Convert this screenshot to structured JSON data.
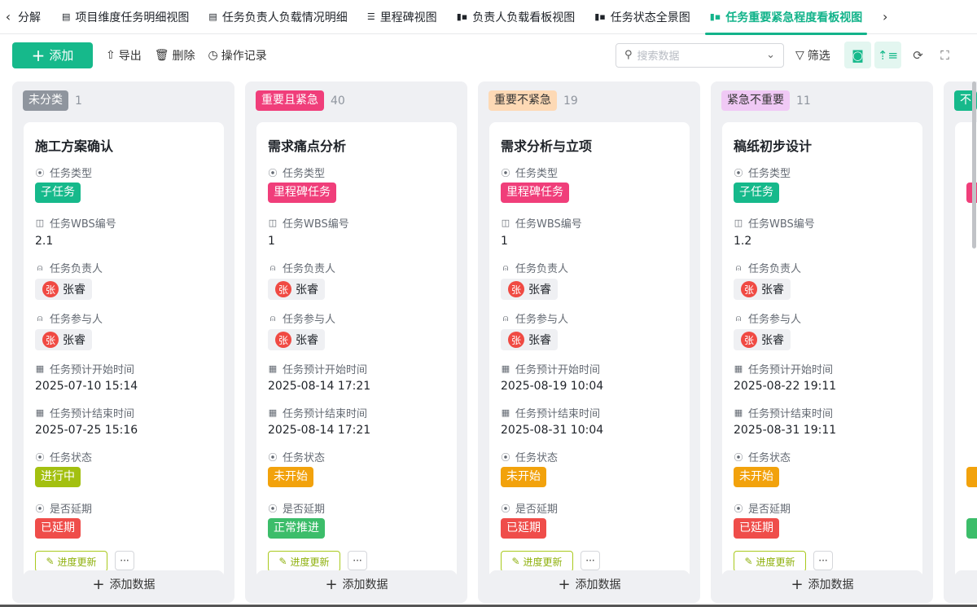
{
  "tabs": [
    {
      "label": "分解",
      "icon": "chevron-left-icon"
    },
    {
      "label": "项目维度任务明细视图",
      "icon": "table-icon"
    },
    {
      "label": "任务负责人负载情况明细",
      "icon": "table-icon"
    },
    {
      "label": "里程碑视图",
      "icon": "milestone-icon"
    },
    {
      "label": "负责人负载看板视图",
      "icon": "kanban-icon"
    },
    {
      "label": "任务状态全景图",
      "icon": "kanban-icon"
    },
    {
      "label": "任务重要紧急程度看板视图",
      "icon": "kanban-icon",
      "active": true
    }
  ],
  "toolbar": {
    "add": "添加",
    "export": "导出",
    "delete": "删除",
    "history": "操作记录",
    "search_placeholder": "搜索数据",
    "filter": "筛选"
  },
  "field_labels": {
    "type": "任务类型",
    "wbs": "任务WBS编号",
    "owner": "任务负责人",
    "participants": "任务参与人",
    "start": "任务预计开始时间",
    "end": "任务预计结束时间",
    "status": "任务状态",
    "delay": "是否延期"
  },
  "card_actions": {
    "progress": "进度更新",
    "more": "···"
  },
  "add_data": "添加数据",
  "colors": {
    "accent": "#16b98b",
    "sub_task": "#16b98b",
    "milestone": "#f03e7a",
    "in_progress": "#a3c010",
    "not_started": "#f2a20c",
    "delayed": "#ef4d4a",
    "normal": "#3cbd6a"
  },
  "columns": [
    {
      "label": "未分类",
      "count": "1",
      "bg": "#8f959e",
      "fg": "#fff",
      "card": {
        "title": "施工方案确认",
        "type": "子任务",
        "type_color": "#16b98b",
        "wbs": "2.1",
        "owner": "张睿",
        "owner_initial": "张",
        "participant": "张睿",
        "participant_initial": "张",
        "start": "2025-07-10 15:14",
        "end": "2025-07-25 15:16",
        "status": "进行中",
        "status_color": "#a3c010",
        "delay": "已延期",
        "delay_color": "#ef4d4a"
      }
    },
    {
      "label": "重要且紧急",
      "count": "40",
      "bg": "#f03e7a",
      "fg": "#fff",
      "card": {
        "title": "需求痛点分析",
        "type": "里程碑任务",
        "type_color": "#f03e7a",
        "wbs": "1",
        "owner": "张睿",
        "owner_initial": "张",
        "participant": "张睿",
        "participant_initial": "张",
        "start": "2025-08-14 17:21",
        "end": "2025-08-14 17:21",
        "status": "未开始",
        "status_color": "#f2a20c",
        "delay": "正常推进",
        "delay_color": "#3cbd6a"
      }
    },
    {
      "label": "重要不紧急",
      "count": "19",
      "bg": "#fdd9b5",
      "fg": "#333",
      "card": {
        "title": "需求分析与立项",
        "type": "里程碑任务",
        "type_color": "#f03e7a",
        "wbs": "1",
        "owner": "张睿",
        "owner_initial": "张",
        "participant": "张睿",
        "participant_initial": "张",
        "start": "2025-08-19 10:04",
        "end": "2025-08-31 10:04",
        "status": "未开始",
        "status_color": "#f2a20c",
        "delay": "已延期",
        "delay_color": "#ef4d4a"
      }
    },
    {
      "label": "紧急不重要",
      "count": "11",
      "bg": "#f0c9f5",
      "fg": "#333",
      "card": {
        "title": "稿纸初步设计",
        "type": "子任务",
        "type_color": "#16b98b",
        "wbs": "1.2",
        "owner": "张睿",
        "owner_initial": "张",
        "participant": "张睿",
        "participant_initial": "张",
        "start": "2025-08-22 19:11",
        "end": "2025-08-31 19:11",
        "status": "未开始",
        "status_color": "#f2a20c",
        "delay": "已延期",
        "delay_color": "#ef4d4a"
      }
    },
    {
      "label": "不",
      "bg": "#16b98b",
      "fg": "#fff",
      "partial": true,
      "card": {
        "type_color": "#f03e7a",
        "status_color": "#f2a20c",
        "delay_color": "#3cbd6a"
      }
    }
  ]
}
